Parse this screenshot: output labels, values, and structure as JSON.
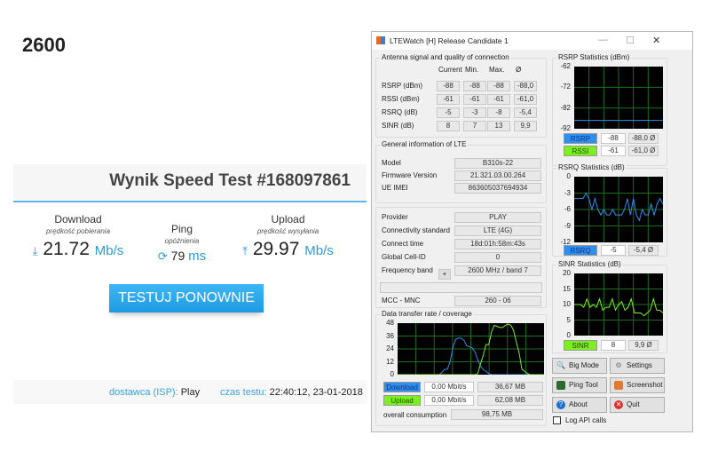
{
  "band_label": "2600",
  "speedtest": {
    "title": "Wynik Speed Test #168097861",
    "download": {
      "label": "Download",
      "sub": "prędkość pobierania",
      "value": "21.72",
      "unit": "Mb/s"
    },
    "ping": {
      "label": "Ping",
      "sub": "opóźnienia",
      "value": "79",
      "unit": "ms"
    },
    "upload": {
      "label": "Upload",
      "sub": "prędkość wysyłania",
      "value": "29.97",
      "unit": "Mb/s"
    },
    "retest_label": "TESTUJ PONOWNIE",
    "isp_label": "dostawca (ISP):",
    "isp_value": "Play",
    "time_label": "czas testu:",
    "time_value": "22:40:12, 23-01-2018"
  },
  "ltewatch": {
    "title": "LTEWatch [H]   Release Candidate 1",
    "antenna": {
      "title": "Antenna signal and quality of connection",
      "headers": [
        "Current",
        "Min.",
        "Max.",
        "Ø"
      ],
      "rows": [
        {
          "label": "RSRP (dBm)",
          "values": [
            "-88",
            "-88",
            "-88",
            "-88,0"
          ]
        },
        {
          "label": "RSSI (dBm)",
          "values": [
            "-61",
            "-61",
            "-61",
            "-61,0"
          ]
        },
        {
          "label": "RSRQ (dB)",
          "values": [
            "-5",
            "-3",
            "-8",
            "-5,4"
          ]
        },
        {
          "label": "SINR (dB)",
          "values": [
            "8",
            "7",
            "13",
            "9,9"
          ]
        }
      ]
    },
    "general": {
      "title": "General information of LTE",
      "rows": [
        {
          "label": "Model",
          "value": "B310s-22"
        },
        {
          "label": "Firmware Version",
          "value": "21.321.03.00.264"
        },
        {
          "label": "UE IMEI",
          "value": "863605037694934"
        }
      ]
    },
    "network": {
      "rows": [
        {
          "label": "Provider",
          "value": "PLAY"
        },
        {
          "label": "Connectivity standard",
          "value": "LTE (4G)"
        },
        {
          "label": "Connect time",
          "value": "18d:01h:58m:43s"
        },
        {
          "label": "Global Cell-ID",
          "value": "0"
        },
        {
          "label": "Frequency band",
          "value": "2600 MHz / band 7"
        }
      ],
      "band_button": "+",
      "mcc_label": "MCC - MNC",
      "mcc_value": "260 - 06"
    },
    "transfer": {
      "title": "Data transfer rate / coverage",
      "yticks": [
        "48",
        "36",
        "24",
        "12",
        "0"
      ],
      "ymax": 48,
      "download_series": [
        0,
        0,
        0,
        0,
        0,
        0,
        0,
        0,
        0,
        0,
        0,
        0,
        0,
        0,
        0,
        0,
        2,
        5,
        5,
        12,
        25,
        33,
        34,
        34,
        32,
        27,
        26,
        25,
        21,
        14,
        8,
        5,
        3,
        1,
        0,
        0,
        0,
        0,
        0,
        0,
        0,
        0,
        0,
        0,
        0,
        0,
        0,
        0,
        0,
        0,
        0,
        0,
        0,
        0
      ],
      "upload_series": [
        0,
        0,
        0,
        0,
        0,
        0,
        0,
        0,
        0,
        0,
        0,
        0,
        0,
        0,
        0,
        0,
        0,
        0,
        0,
        0,
        0,
        0,
        0,
        0,
        0,
        0,
        0,
        0,
        0,
        1,
        10,
        18,
        28,
        28,
        40,
        46,
        45,
        44,
        44,
        46,
        47,
        46,
        41,
        30,
        20,
        5,
        3,
        1,
        0,
        0,
        0,
        0,
        0,
        0
      ],
      "download_label": "Download",
      "download_rate": "0,00 Mbit/s",
      "download_total": "36,67 MB",
      "upload_label": "Upload",
      "upload_rate": "0,00 Mbit/s",
      "upload_total": "62,08 MB",
      "overall_label": "overall consumption",
      "overall_value": "98,75 MB"
    },
    "rsrp_stats": {
      "title": "RSRP Statistics (dBm)",
      "yticks": [
        "-62",
        "-72",
        "-82",
        "-92"
      ],
      "ymin": -92,
      "ymax": -62,
      "rsrp_series": [
        -88,
        -88
      ],
      "rssi_series": [
        -61,
        -61
      ],
      "rsrp_label": "RSRP",
      "rsrp_cur": "-88",
      "rsrp_avg": "-88,0 Ø",
      "rssi_label": "RSSI",
      "rssi_cur": "-61",
      "rssi_avg": "-61,0 Ø"
    },
    "rsrq_stats": {
      "title": "RSRQ Statistics (dB)",
      "yticks": [
        "0",
        "-3",
        "-6",
        "-9",
        "-12"
      ],
      "ymin": -12,
      "ymax": 0,
      "series": [
        -4,
        -4,
        -4,
        -4,
        -3,
        -4,
        -6,
        -4,
        -6,
        -7,
        -6,
        -7,
        -7,
        -6,
        -7,
        -7,
        -7,
        -6,
        -4,
        -7,
        -4,
        -7,
        -8,
        -6,
        -7,
        -7,
        -5,
        -7,
        -5,
        -4,
        -5
      ],
      "label": "RSRQ",
      "cur": "-5",
      "avg": "-5,4 Ø"
    },
    "sinr_stats": {
      "title": "SINR Statistics (dB)",
      "yticks": [
        "20",
        "15",
        "10",
        "5",
        "0"
      ],
      "ymin": 0,
      "ymax": 22,
      "series": [
        11,
        11,
        11,
        10,
        13,
        10,
        11,
        10,
        13,
        9,
        10,
        10,
        13,
        9,
        11,
        12,
        9,
        10,
        13,
        8,
        8,
        8,
        7,
        8,
        9,
        13,
        9,
        9,
        8
      ],
      "label": "SINR",
      "cur": "8",
      "avg": "9,9 Ø"
    },
    "buttons": {
      "big_mode": "Big Mode",
      "settings": "Settings",
      "ping_tool": "Ping Tool",
      "screenshot": "Screenshot",
      "about": "About",
      "quit": "Quit"
    },
    "log_api": "Log API calls",
    "colors": {
      "download": "#2f8ff0",
      "upload": "#7cf01e",
      "grid": "#1f6b1f"
    }
  }
}
